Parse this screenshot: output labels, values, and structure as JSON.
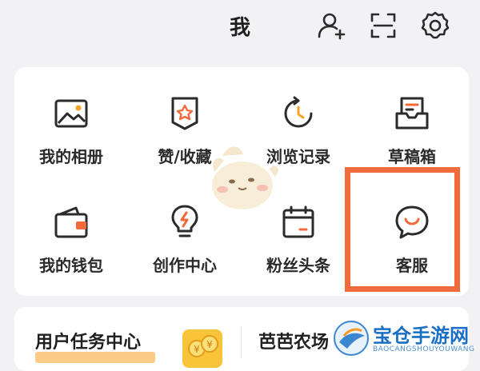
{
  "header": {
    "title": "我",
    "icons": [
      "add-friend-icon",
      "scan-icon",
      "settings-icon"
    ]
  },
  "grid": {
    "items": [
      {
        "label": "我的相册",
        "icon": "photo-album-icon"
      },
      {
        "label": "赞/收藏",
        "icon": "favorites-icon"
      },
      {
        "label": "浏览记录",
        "icon": "history-icon"
      },
      {
        "label": "草稿箱",
        "icon": "drafts-icon"
      },
      {
        "label": "我的钱包",
        "icon": "wallet-icon"
      },
      {
        "label": "创作中心",
        "icon": "creator-icon"
      },
      {
        "label": "粉丝头条",
        "icon": "fan-headline-icon"
      },
      {
        "label": "客服",
        "icon": "customer-service-icon"
      }
    ]
  },
  "tasks": {
    "user_task_title": "用户任务中心",
    "farm_title": "芭芭农场"
  },
  "watermark": {
    "text": "宝仓手游网",
    "sub": "BAOCANGSHOUYOUWANG"
  },
  "colors": {
    "highlight": "#f06a3b",
    "accent_orange": "#f7a227",
    "icon_stroke": "#2b2b2b"
  }
}
